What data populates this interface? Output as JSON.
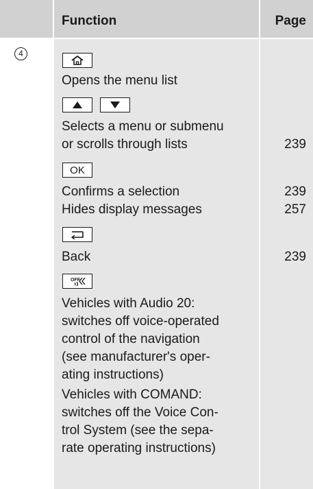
{
  "header": {
    "function_label": "Function",
    "page_label": "Page"
  },
  "row": {
    "number": "4",
    "lines": [
      {
        "text": "Opens the menu list",
        "page": ""
      },
      {
        "text": "Selects a menu or submenu",
        "page": ""
      },
      {
        "text": "or scrolls through lists",
        "page": "239"
      },
      {
        "text": "Confirms a selection",
        "page": "239"
      },
      {
        "text": "Hides display messages",
        "page": "257"
      },
      {
        "text": "Back",
        "page": "239"
      },
      {
        "text": "Vehicles with Audio 20:"
      },
      {
        "text": "switches off voice-operated"
      },
      {
        "text": "control of the navigation"
      },
      {
        "text": "(see manufacturer's oper-"
      },
      {
        "text": "ating instructions)"
      },
      {
        "text": "Vehicles with COMAND:"
      },
      {
        "text": "switches off the Voice Con-"
      },
      {
        "text": "trol System (see the sepa-"
      },
      {
        "text": "rate operating instructions)"
      }
    ],
    "keys": {
      "home": "home-icon",
      "up": "up-triangle-icon",
      "down": "down-triangle-icon",
      "ok_label": "OK",
      "back": "back-arrow-icon",
      "voice_off": "voice-off-icon",
      "voice_off_label": "OFF"
    }
  }
}
